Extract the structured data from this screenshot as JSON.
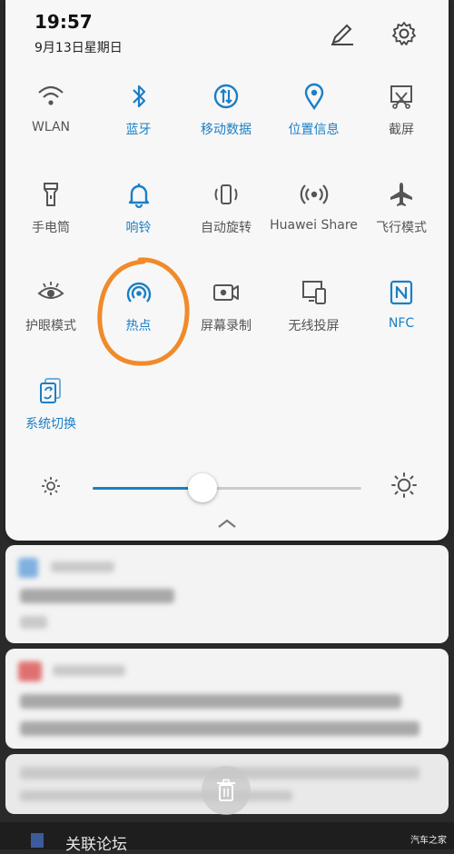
{
  "status": {
    "time": "19:57",
    "date": "9月13日星期日"
  },
  "colors": {
    "accent": "#1a7fc6",
    "inactive": "#555555",
    "annotation": "#f08a2a"
  },
  "tiles": [
    {
      "label": "WLAN",
      "icon": "wifi-icon",
      "active": false
    },
    {
      "label": "蓝牙",
      "icon": "bluetooth-icon",
      "active": true
    },
    {
      "label": "移动数据",
      "icon": "mobile-data-icon",
      "active": true
    },
    {
      "label": "位置信息",
      "icon": "location-icon",
      "active": true
    },
    {
      "label": "截屏",
      "icon": "screenshot-icon",
      "active": false
    },
    {
      "label": "手电筒",
      "icon": "flashlight-icon",
      "active": false
    },
    {
      "label": "响铃",
      "icon": "bell-icon",
      "active": true
    },
    {
      "label": "自动旋转",
      "icon": "auto-rotate-icon",
      "active": false
    },
    {
      "label": "Huawei Share",
      "icon": "huawei-share-icon",
      "active": false
    },
    {
      "label": "飞行模式",
      "icon": "airplane-icon",
      "active": false
    },
    {
      "label": "护眼模式",
      "icon": "eye-icon",
      "active": false
    },
    {
      "label": "热点",
      "icon": "hotspot-icon",
      "active": true
    },
    {
      "label": "屏幕录制",
      "icon": "screen-record-icon",
      "active": false
    },
    {
      "label": "无线投屏",
      "icon": "wireless-projection-icon",
      "active": false
    },
    {
      "label": "NFC",
      "icon": "nfc-icon",
      "active": true
    },
    {
      "label": "系统切换",
      "icon": "system-switch-icon",
      "active": true
    }
  ],
  "brightness": {
    "level_percent": 41
  },
  "bottom": {
    "title": "关联论坛"
  },
  "watermark": "汽车之家"
}
